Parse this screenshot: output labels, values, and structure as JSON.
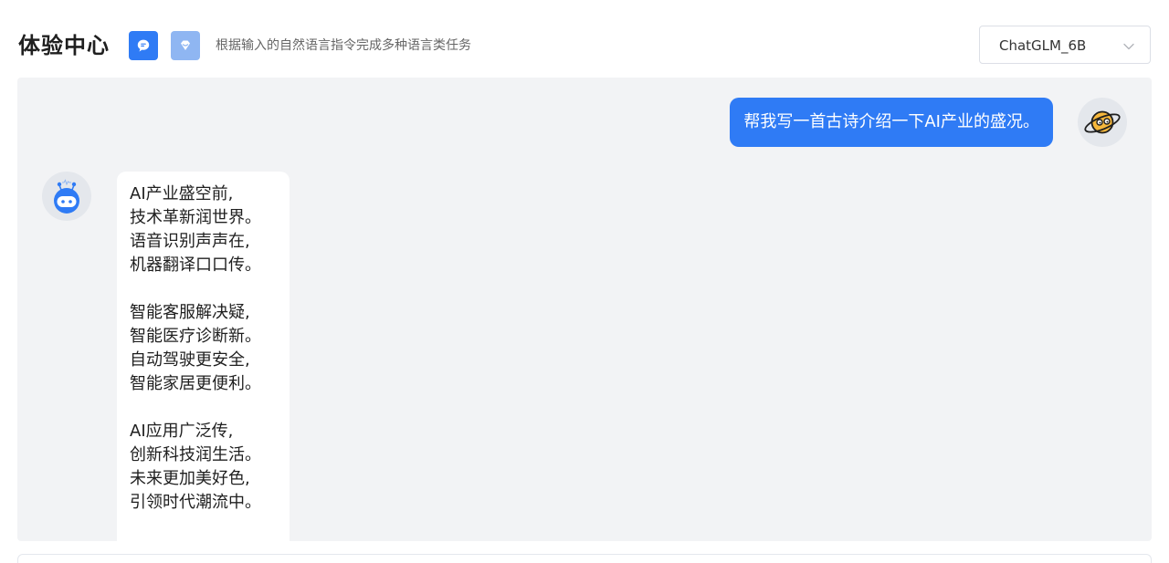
{
  "header": {
    "title": "体验中心",
    "chat_icon": "chat-bubble-icon",
    "gem_icon": "diamond-icon",
    "subtitle": "根据输入的自然语言指令完成多种语言类任务",
    "model": {
      "selected": "ChatGLM_6B",
      "icon": "chevron-down-icon"
    }
  },
  "colors": {
    "accent": "#2f7bf5",
    "accent_light": "#8fb6f2",
    "chat_bg": "#f2f3f5"
  },
  "conversation": {
    "user_message": "帮我写一首古诗介绍一下AI产业的盛况。",
    "user_avatar": "planet-avatar-icon",
    "bot_avatar": "robot-avatar-icon",
    "bot_reply": {
      "stanzas": [
        [
          "AI产业盛空前,",
          "技术革新润世界。",
          "语音识别声声在,",
          "机器翻译口口传。"
        ],
        [
          "智能客服解决疑,",
          "智能医疗诊断新。",
          "自动驾驶更安全,",
          "智能家居更便利。"
        ],
        [
          "AI应用广泛传,",
          "创新科技润生活。",
          "未来更加美好色,",
          "引领时代潮流中。"
        ]
      ]
    }
  }
}
